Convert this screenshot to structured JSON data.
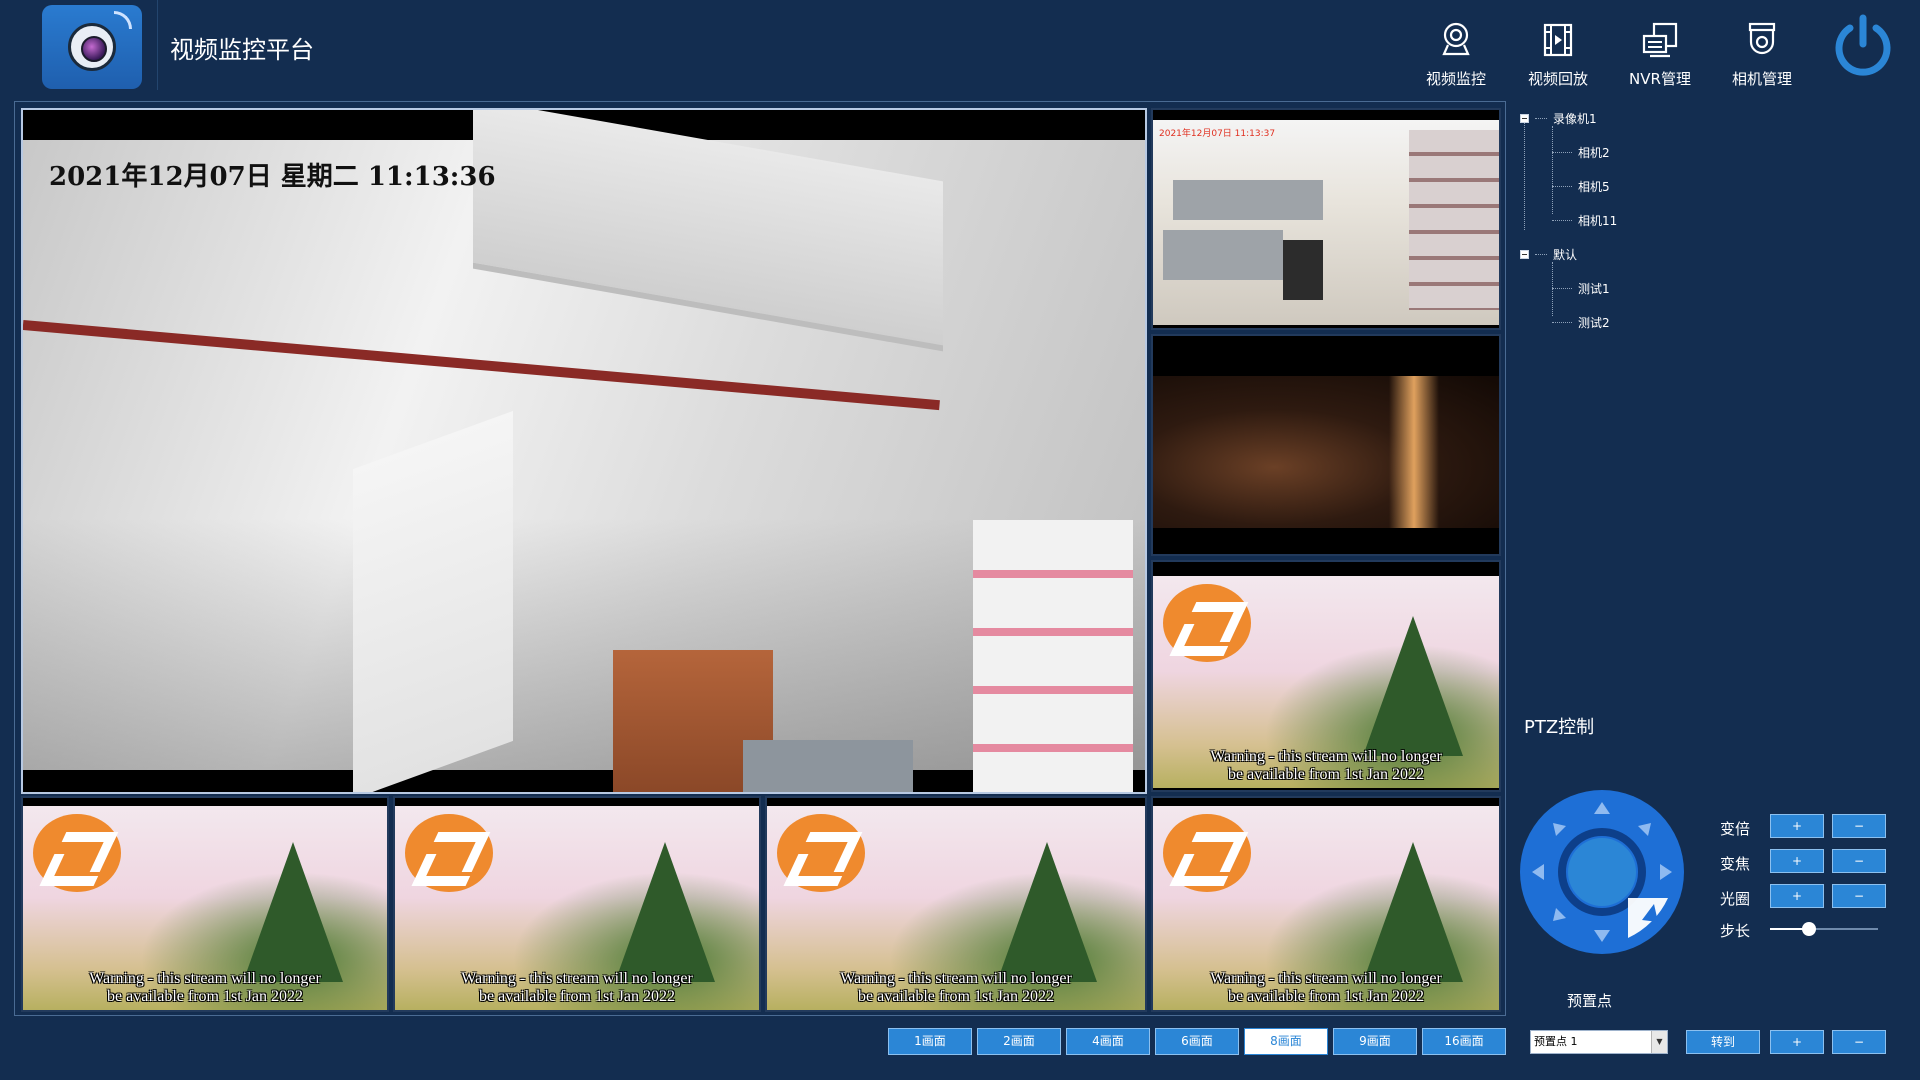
{
  "app": {
    "title": "视频监控平台"
  },
  "nav": [
    {
      "label": "视频监控",
      "icon": "monitor-pin-icon"
    },
    {
      "label": "视频回放",
      "icon": "film-playback-icon"
    },
    {
      "label": "NVR管理",
      "icon": "nvr-devices-icon"
    },
    {
      "label": "相机管理",
      "icon": "dome-camera-icon"
    }
  ],
  "power": {
    "icon": "power-icon"
  },
  "video": {
    "main_osd": "2021年12月07日  星期二  11:13:36",
    "office_osd": "2021年12月07日  11:13:37",
    "warning_line1": "Warning - this stream will no longer",
    "warning_line2": "be available from 1st Jan 2022"
  },
  "tree": {
    "groups": [
      {
        "label": "录像机1",
        "children": [
          "相机2",
          "相机5",
          "相机11"
        ]
      },
      {
        "label": "默认",
        "children": [
          "测试1",
          "测试2"
        ]
      }
    ]
  },
  "ptz": {
    "title": "PTZ控制",
    "controls": [
      {
        "label": "变倍",
        "plus": "+",
        "minus": "−"
      },
      {
        "label": "变焦",
        "plus": "+",
        "minus": "−"
      },
      {
        "label": "光圈",
        "plus": "+",
        "minus": "−"
      }
    ],
    "step": {
      "label": "步长",
      "value": 0.36
    },
    "accent": "#2b86d6"
  },
  "preset": {
    "title": "预置点",
    "selected": "预置点 1",
    "goto_label": "转到",
    "plus": "+",
    "minus": "−"
  },
  "layouts": {
    "options": [
      "1画面",
      "2画面",
      "4画面",
      "6画面",
      "8画面",
      "9画面",
      "16画面"
    ],
    "selected_index": 4
  }
}
